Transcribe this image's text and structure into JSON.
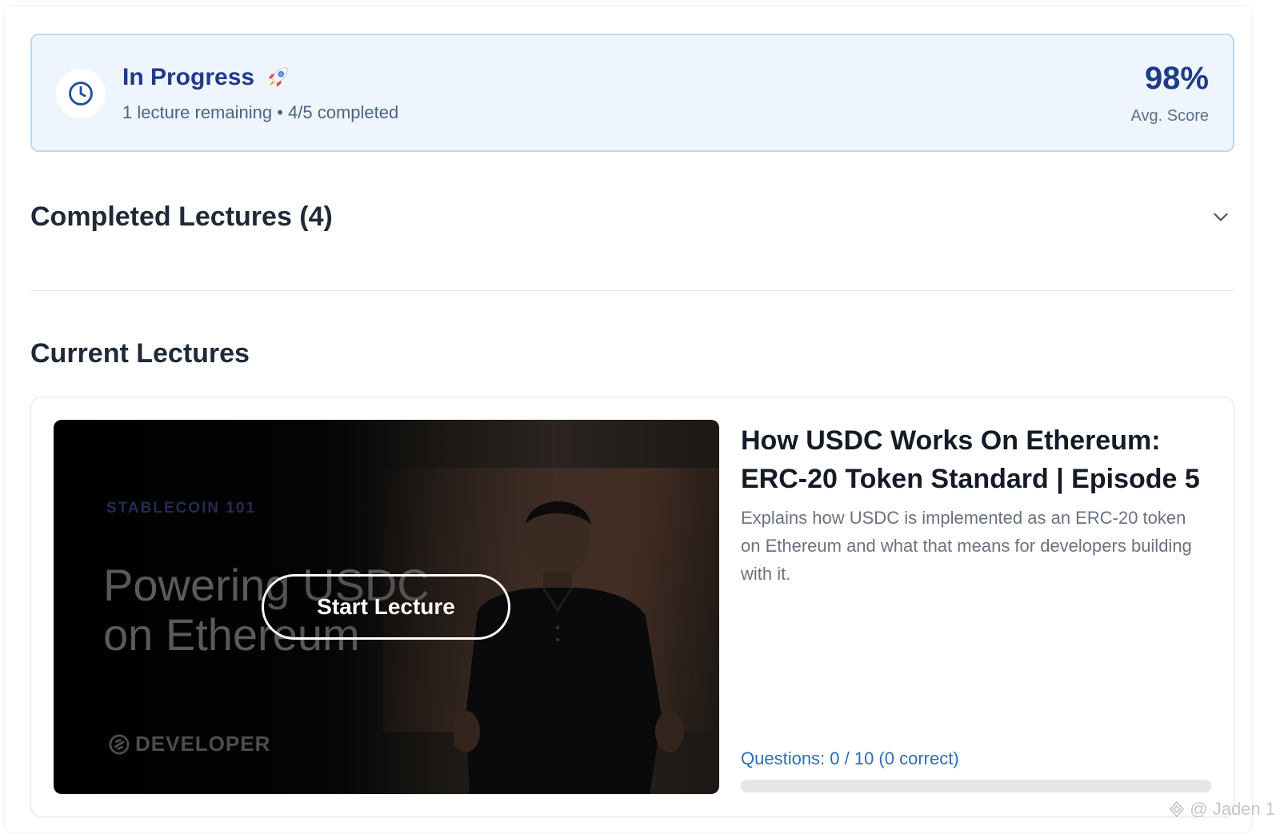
{
  "status": {
    "title": "In Progress",
    "subtitle": "1 lecture remaining • 4/5 completed",
    "score_value": "98%",
    "score_label": "Avg. Score",
    "icon": "clock-icon",
    "title_emoji_icon": "rocket-icon"
  },
  "completed_section": {
    "title": "Completed Lectures (4)",
    "toggle_icon": "chevron-down-icon"
  },
  "current_section": {
    "title": "Current Lectures"
  },
  "lecture": {
    "thumbnail": {
      "kicker": "STABLECOIN 101",
      "headline_line1": "Powering USDC",
      "headline_line2": "on Ethereum",
      "brand": "DEVELOPER"
    },
    "start_label": "Start Lecture",
    "title": "How USDC Works On Ethereum: ERC-20 Token Standard | Episode 5",
    "description": "Explains how USDC is implemented as an ERC-20 token on Ethereum and what that means for developers building with it.",
    "questions_text": "Questions: 0 / 10 (0 correct)",
    "progress_fraction": 0
  },
  "watermark": "@ Jaden 1",
  "colors": {
    "accent": "#1e3a8a",
    "banner_bg": "#eef5fd",
    "banner_border": "#bcd9f3",
    "link": "#2f6db3"
  }
}
